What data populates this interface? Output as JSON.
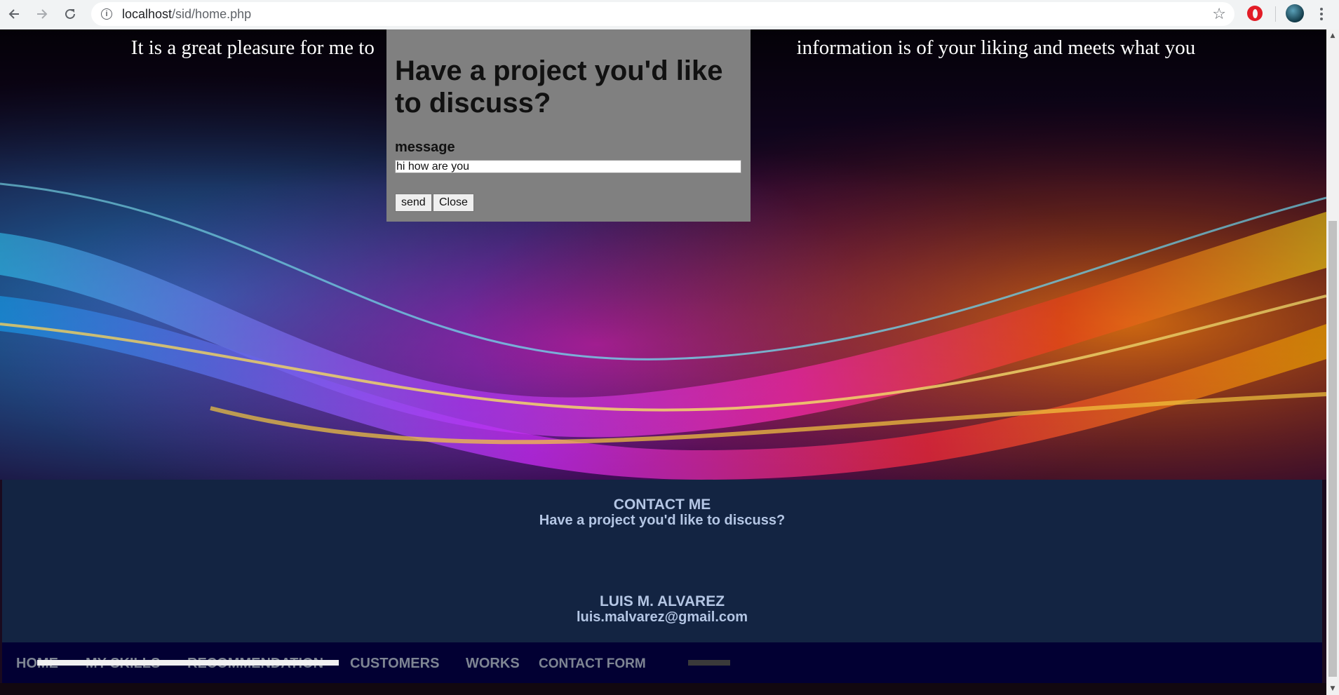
{
  "browser": {
    "url_host": "localhost",
    "url_path": "/sid/home.php",
    "icons": [
      "back-arrow-icon",
      "forward-arrow-icon",
      "reload-icon",
      "info-icon",
      "bookmark-star-icon",
      "opera-extension-icon",
      "profile-avatar",
      "menu-dots-icon"
    ]
  },
  "hero": {
    "intro_text": "It is a great pleasure for me to                                                                                   information is of your liking and meets what you"
  },
  "modal": {
    "title": "Have a project you'd like to discuss?",
    "message_label": "message",
    "message_value": "hi how are you",
    "send_label": "send",
    "close_label": "Close",
    "background_color": "#808080"
  },
  "contact": {
    "heading": "CONTACT ME",
    "subheading": "Have a project you'd like to discuss?",
    "name": "LUIS M. ALVAREZ",
    "email": "luis.malvarez@gmail.com",
    "background_color": "#132442",
    "text_color": "#b4c6e4"
  },
  "nav": {
    "items": [
      {
        "label": "HOME"
      },
      {
        "label": "MY SKILLS"
      },
      {
        "label": "RECOMMENDATION"
      },
      {
        "label": "CUSTOMERS"
      },
      {
        "label": "WORKS"
      },
      {
        "label": "CONTACT FORM"
      }
    ],
    "background_color": "#020033"
  }
}
